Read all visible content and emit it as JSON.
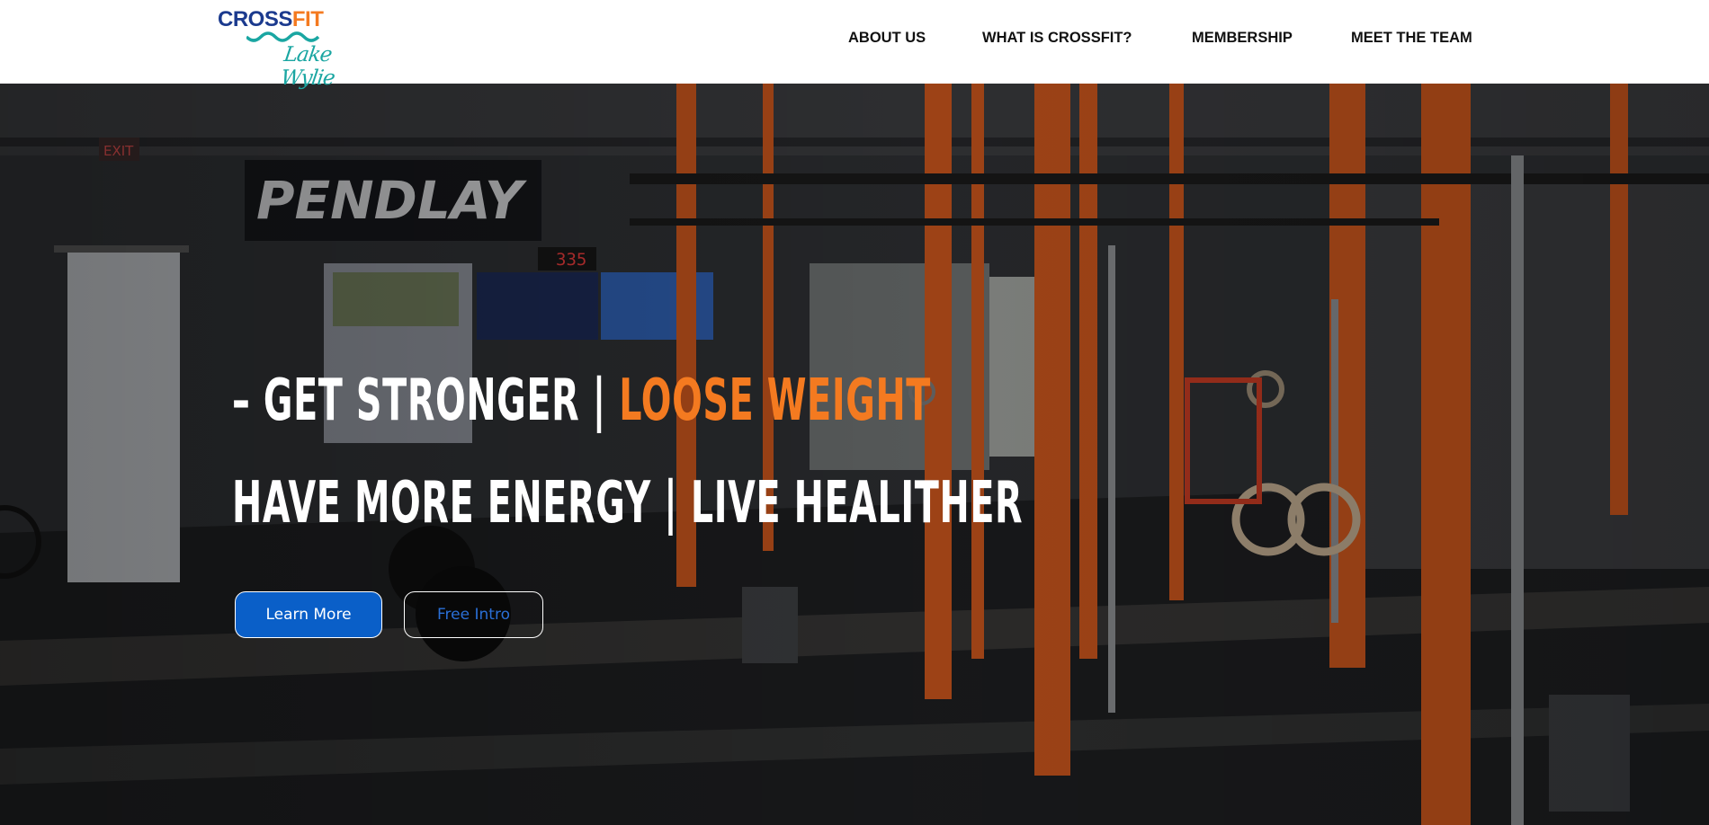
{
  "header": {
    "logo": {
      "brand_cross": "CROSS",
      "brand_fit": "FIT",
      "script": "Lake Wylie"
    },
    "nav": [
      {
        "label": "ABOUT US"
      },
      {
        "label": "WHAT IS CROSSFIT?"
      },
      {
        "label": "MEMBERSHIP"
      },
      {
        "label": "MEET THE TEAM"
      }
    ]
  },
  "hero": {
    "line1_white": "– GET STRONGER | ",
    "line1_orange": "LOOSE WEIGHT",
    "line2": "HAVE MORE ENERGY | LIVE HEALITHER",
    "buttons": {
      "learn_more": "Learn More",
      "free_intro": "Free Intro"
    }
  },
  "colors": {
    "accent_orange": "#f47a20",
    "brand_blue": "#1b3a8e",
    "button_blue": "#0a5fc8",
    "logo_teal": "#1aa6a2"
  }
}
